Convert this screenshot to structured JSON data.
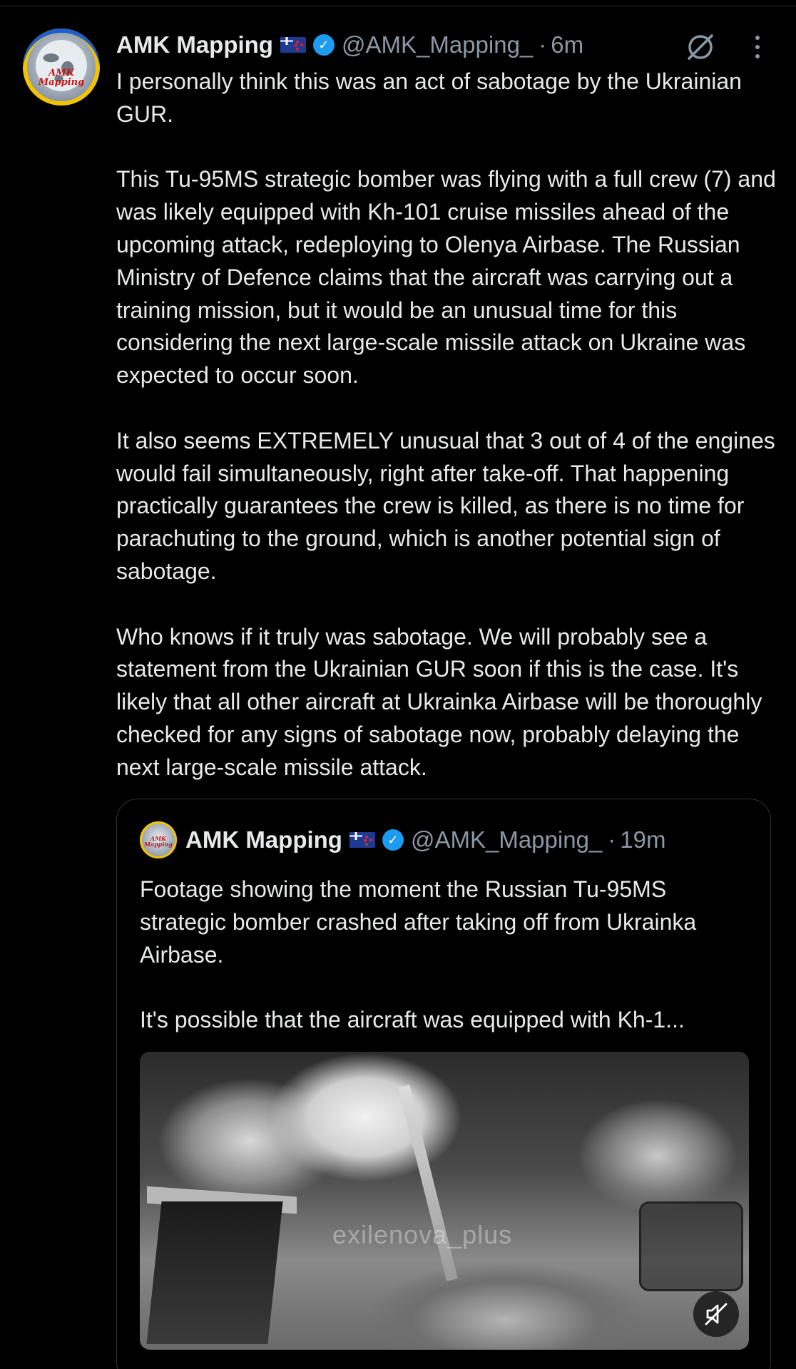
{
  "tweet": {
    "author_name": "AMK Mapping",
    "handle": "@AMK_Mapping_",
    "separator": "·",
    "time": "6m",
    "avatar_text": "AMK\nMapping",
    "paragraphs": [
      "I personally think this was an act of sabotage by the Ukrainian GUR.",
      "This Tu-95MS strategic bomber was flying with a full crew (7) and was likely equipped with Kh-101 cruise missiles ahead of the upcoming attack, redeploying to Olenya Airbase. The Russian Ministry of Defence claims that the aircraft was carrying out a training mission, but it would be an unusual time for this considering the next large-scale missile attack on Ukraine was expected to occur soon.",
      "It also seems EXTREMELY unusual that 3 out of 4 of the engines would fail simultaneously, right after take-off. That happening practically guarantees the crew is killed, as there is no time for parachuting to the ground, which is another potential sign of sabotage.",
      "Who knows if it truly was sabotage. We will probably see a statement from the Ukrainian GUR soon if this is the case. It's likely that all other aircraft at Ukrainka Airbase will be thoroughly checked for any signs of sabotage now, probably delaying the next large-scale missile attack."
    ]
  },
  "quoted_tweet": {
    "author_name": "AMK Mapping",
    "handle": "@AMK_Mapping_",
    "separator": "·",
    "time": "19m",
    "avatar_text": "AMK\nMapping",
    "paragraphs": [
      "Footage showing the moment the Russian Tu-95MS strategic bomber crashed after taking off from Ukrainka Airbase.",
      "It's possible that the aircraft was equipped with Kh-1..."
    ],
    "media_watermark": "exilenova_plus"
  },
  "icons": {
    "verified": "verified-badge-icon",
    "flag": "new-zealand-flag-icon",
    "grok": "grok-icon",
    "more": "more-options-icon",
    "mute": "speaker-muted-icon"
  },
  "colors": {
    "background": "#000000",
    "text_primary": "#e7e9ea",
    "text_secondary": "#8b98a5",
    "verified_blue": "#1d9bf0",
    "border": "#2f3336"
  }
}
